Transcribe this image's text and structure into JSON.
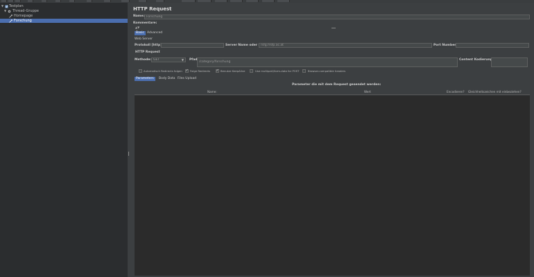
{
  "tree": {
    "items": [
      {
        "label": "Testplan"
      },
      {
        "label": "Thread-Gruppe"
      },
      {
        "label": "Homepage"
      },
      {
        "label": "Forschung"
      }
    ]
  },
  "panel": {
    "title": "HTTP Request",
    "name_label": "Name:",
    "name_value": "Forschung",
    "comments_label": "Kommentare:",
    "tabs": [
      "Basic",
      "Advanced"
    ],
    "web_server_heading": "Web Server",
    "protocol_label": "Protokoll [http]:",
    "server_label": "Server Name oder IP:",
    "server_value": "rsfg.frsfp.ac.at",
    "port_label": "Port Number:",
    "http_request_heading": "HTTP Request",
    "method_label": "Methode:",
    "method_value": "GET",
    "path_label": "Pfad:",
    "path_value": "/category/forschung",
    "encoding_label": "Content Kodierung:",
    "options": [
      {
        "label": "Automatisch Redirects folgen",
        "checked": false
      },
      {
        "label": "Folge Redirects",
        "checked": true
      },
      {
        "label": "Benutze KeepAlive",
        "checked": true
      },
      {
        "label": "Use multipart/form-data for POST",
        "checked": false
      },
      {
        "label": "Browser-compatible headers",
        "checked": false
      }
    ],
    "param_tabs": [
      "Parameters",
      "Body Data",
      "Files Upload"
    ],
    "table_caption": "Parameter die mit dem Request gesendet werden:",
    "columns": [
      "Name:",
      "Wert",
      "Encodieren?",
      "Gleichheitszeichen mit einbeziehen?"
    ]
  },
  "colors": {
    "selection": "#4b6eaf",
    "background": "#3c3f41"
  }
}
